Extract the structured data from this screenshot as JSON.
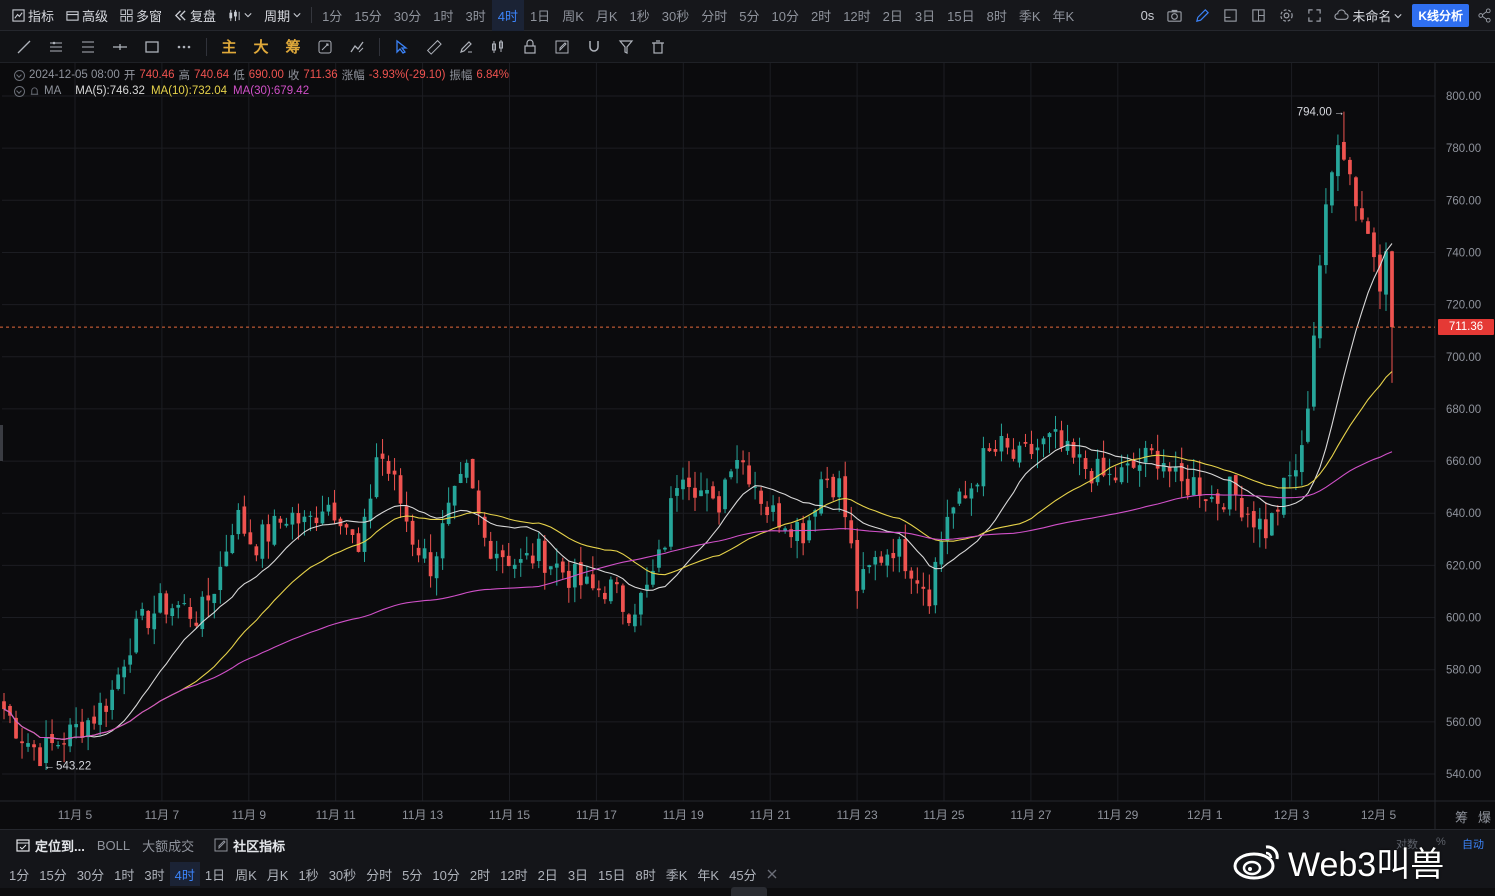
{
  "topbar": {
    "indicator": "指标",
    "advanced": "高级",
    "multi_window": "多窗",
    "replay": "复盘",
    "period": "周期",
    "timeframes": [
      "1分",
      "15分",
      "30分",
      "1时",
      "3时",
      "4时",
      "1日",
      "周K",
      "月K",
      "1秒",
      "30秒",
      "分时",
      "5分",
      "10分",
      "2时",
      "12时",
      "2日",
      "3日",
      "15日",
      "8时",
      "季K",
      "年K"
    ],
    "active_timeframe": "4时",
    "delay": "0s",
    "layout_name": "未命名",
    "kline_badge": "K线分析"
  },
  "drawbar": {
    "text_tools": [
      "主",
      "大",
      "筹"
    ]
  },
  "info": {
    "datetime": "2024-12-05 08:00",
    "open_label": "开",
    "open": "740.46",
    "high_label": "高",
    "high": "740.64",
    "low_label": "低",
    "low": "690.00",
    "close_label": "收",
    "close": "711.36",
    "change_label": "涨幅",
    "change": "-3.93%(-29.10)",
    "amp_label": "振幅",
    "amp": "6.84%",
    "ma_name": "MA",
    "ma5": "MA(5):746.32",
    "ma10": "MA(10):732.04",
    "ma30": "MA(30):679.42"
  },
  "colors": {
    "up": "#26a69a",
    "down": "#ef5350",
    "ma5": "#d8d8d8",
    "ma10": "#e6d24a",
    "ma30": "#d050c8",
    "accent": "#3b82f6"
  },
  "chart_data": {
    "type": "candlestick",
    "y_ticks": [
      "800.00",
      "780.00",
      "760.00",
      "740.00",
      "720.00",
      "700.00",
      "680.00",
      "660.00",
      "640.00",
      "620.00",
      "600.00",
      "580.00",
      "560.00",
      "540.00"
    ],
    "x_ticks": [
      "11月 5",
      "11月 7",
      "11月 9",
      "11月 11",
      "11月 13",
      "11月 15",
      "11月 17",
      "11月 19",
      "11月 21",
      "11月 23",
      "11月 25",
      "11月 27",
      "11月 29",
      "12月 1",
      "12月 3",
      "12月 5"
    ],
    "ylim": [
      535,
      810
    ],
    "current_price": "711.36",
    "max_marker": "794.00",
    "min_marker": "543.22",
    "anchor_close": [
      565,
      555,
      548,
      552,
      557,
      562,
      570,
      590,
      600,
      605,
      604,
      600,
      615,
      640,
      628,
      633,
      640,
      635,
      645,
      640,
      622,
      665,
      650,
      630,
      620,
      640,
      655,
      630,
      625,
      620,
      625,
      620,
      615,
      610,
      612,
      603,
      608,
      625,
      660,
      650,
      640,
      665,
      655,
      640,
      638,
      633,
      655,
      650,
      610,
      622,
      628,
      620,
      610,
      640,
      645,
      660,
      665,
      660,
      665,
      668,
      660,
      657,
      653,
      655,
      660,
      663,
      650,
      652,
      645,
      649,
      640,
      633,
      650,
      663,
      740,
      788,
      760,
      740,
      711.36
    ]
  },
  "bottom": {
    "locate": "定位到...",
    "boll": "BOLL",
    "big_vol": "大额成交",
    "community": "社区指标",
    "timeframes": [
      "1分",
      "15分",
      "30分",
      "1时",
      "3时",
      "4时",
      "1日",
      "周K",
      "月K",
      "1秒",
      "30秒",
      "分时",
      "5分",
      "10分",
      "2时",
      "12时",
      "2日",
      "3日",
      "15日",
      "8时",
      "季K",
      "年K",
      "45分"
    ],
    "active_timeframe": "4时",
    "pair_label": "对数",
    "pct_label": "%",
    "auto_label": "自动",
    "corner_1": "筹",
    "corner_2": "爆",
    "watermark": "Web3叫兽"
  }
}
